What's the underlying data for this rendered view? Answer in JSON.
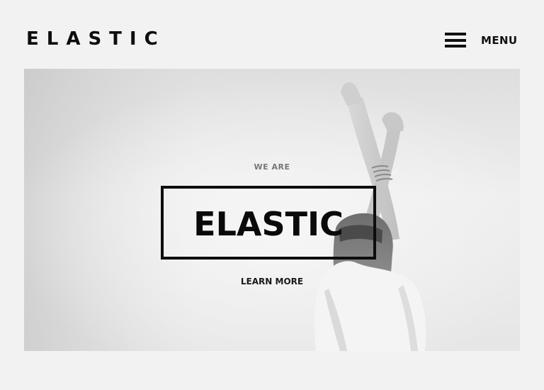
{
  "header": {
    "logo": "ELASTIC",
    "menu_label": "MENU"
  },
  "hero": {
    "eyebrow": "WE ARE",
    "title": "ELASTIC",
    "cta_label": "LEARN MORE"
  },
  "colors": {
    "page_background": "#f2f2f2",
    "text": "#111111",
    "eyebrow_text": "#777777"
  },
  "icons": {
    "menu": "hamburger-icon"
  }
}
